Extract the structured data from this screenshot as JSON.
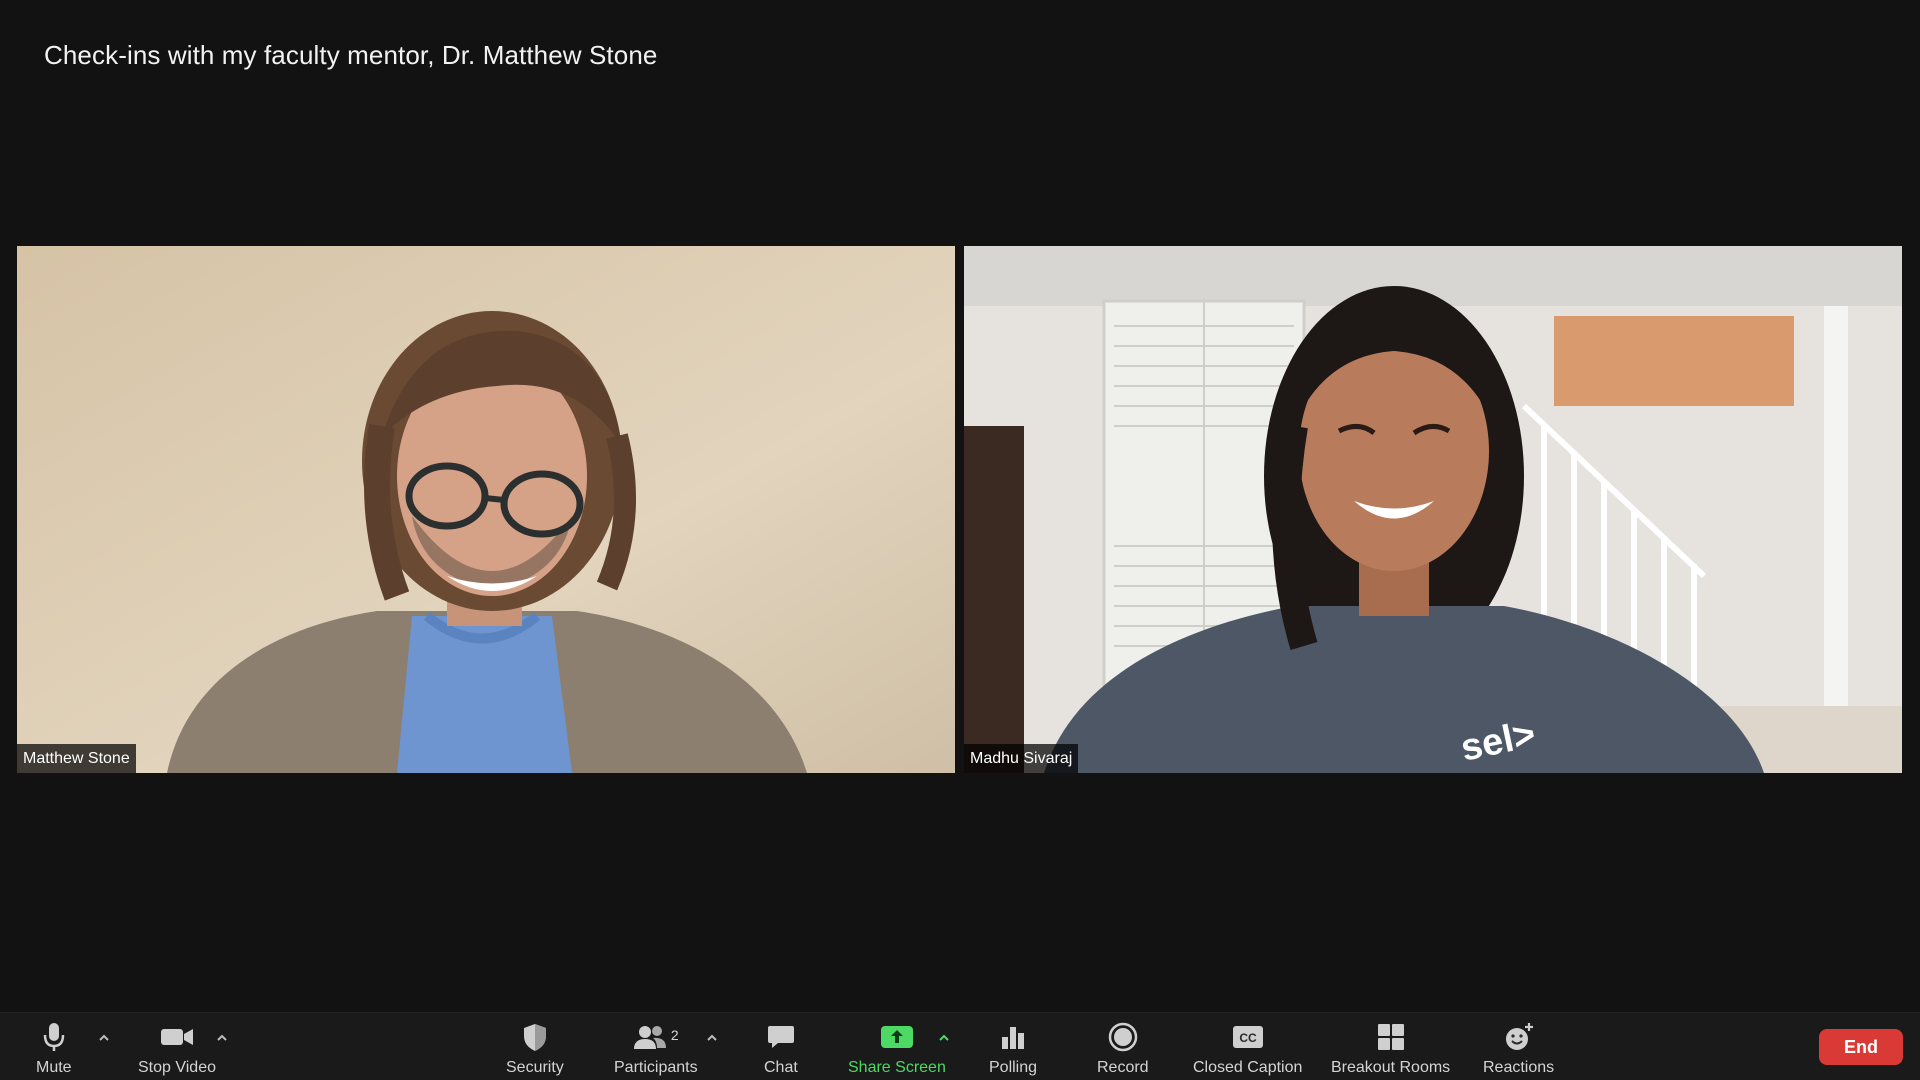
{
  "meeting": {
    "title": "Check-ins with my faculty mentor, Dr. Matthew Stone"
  },
  "participants": [
    {
      "name": "Matthew Stone"
    },
    {
      "name": "Madhu Sivaraj"
    }
  ],
  "toolbar": {
    "mute_label": "Mute",
    "stop_video_label": "Stop Video",
    "security_label": "Security",
    "participants_label": "Participants",
    "participants_count": "2",
    "chat_label": "Chat",
    "share_screen_label": "Share Screen",
    "polling_label": "Polling",
    "record_label": "Record",
    "closed_caption_label": "Closed Caption",
    "cc_badge": "CC",
    "breakout_rooms_label": "Breakout Rooms",
    "reactions_label": "Reactions",
    "end_label": "End"
  },
  "colors": {
    "background": "#121213",
    "toolbar": "#1a1a1a",
    "share_green": "#4cd964",
    "end_red": "#d93a36"
  },
  "icons": [
    "microphone-icon",
    "video-camera-icon",
    "shield-icon",
    "people-icon",
    "chat-bubble-icon",
    "share-screen-icon",
    "bar-chart-icon",
    "record-icon",
    "closed-caption-icon",
    "grid-icon",
    "smiley-plus-icon",
    "chevron-up-icon"
  ]
}
